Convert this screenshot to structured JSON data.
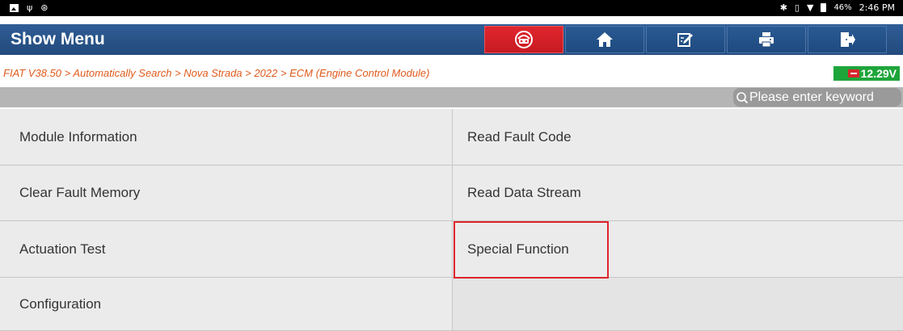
{
  "status_bar": {
    "left_icons": [
      "image-icon",
      "usb-icon",
      "accessibility-icon"
    ],
    "right_icons": [
      "bluetooth-icon",
      "vibrate-icon",
      "wifi-icon",
      "battery-icon"
    ],
    "battery": "46%",
    "time": "2:46 PM"
  },
  "header": {
    "title": "Show Menu",
    "toolbar": [
      {
        "name": "diagnostic-icon",
        "color": "#e0262e"
      },
      {
        "name": "home-icon"
      },
      {
        "name": "edit-icon"
      },
      {
        "name": "print-icon"
      },
      {
        "name": "exit-icon"
      }
    ]
  },
  "breadcrumb": {
    "path": "FIAT V38.50 > Automatically Search > Nova Strada > 2022 > ECM (Engine Control Module)",
    "color": "#e05a1c"
  },
  "voltage": {
    "value": "12.29V",
    "color": "#1ea53a"
  },
  "search": {
    "placeholder": "Please enter keyword"
  },
  "menu": {
    "items": [
      "Module Information",
      "Read Fault Code",
      "Clear Fault Memory",
      "Read Data Stream",
      "Actuation Test",
      "Special Function",
      "Configuration",
      ""
    ],
    "highlighted_item": "Special Function",
    "highlight_color": "#e0232b"
  }
}
